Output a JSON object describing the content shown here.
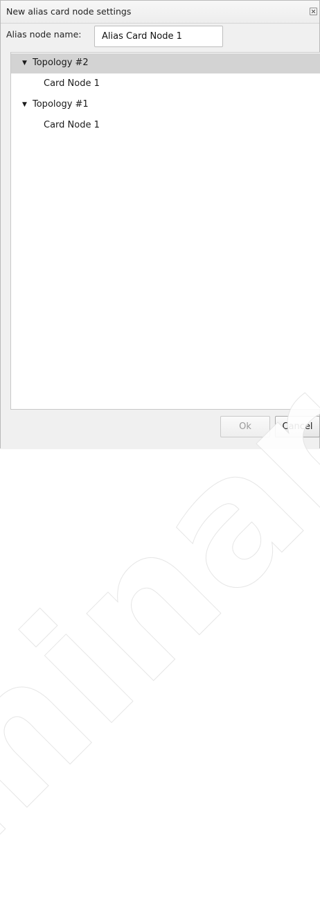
{
  "window": {
    "title": "New alias card node settings"
  },
  "form": {
    "name_label": "Alias node name:",
    "name_value": "Alias Card Node 1"
  },
  "tree": {
    "groups": [
      {
        "label": "Topology #2",
        "child": "Card Node 1",
        "expanded": true,
        "selected": true
      },
      {
        "label": "Topology #1",
        "child": "Card Node 1",
        "expanded": true,
        "selected": false
      }
    ]
  },
  "footer": {
    "ok_label": "Ok",
    "cancel_label": "Cancel",
    "ok_enabled": false
  },
  "watermark": {
    "text": "iminar"
  },
  "icons": {
    "expand": "triangle-down-icon",
    "close": "close-icon"
  }
}
